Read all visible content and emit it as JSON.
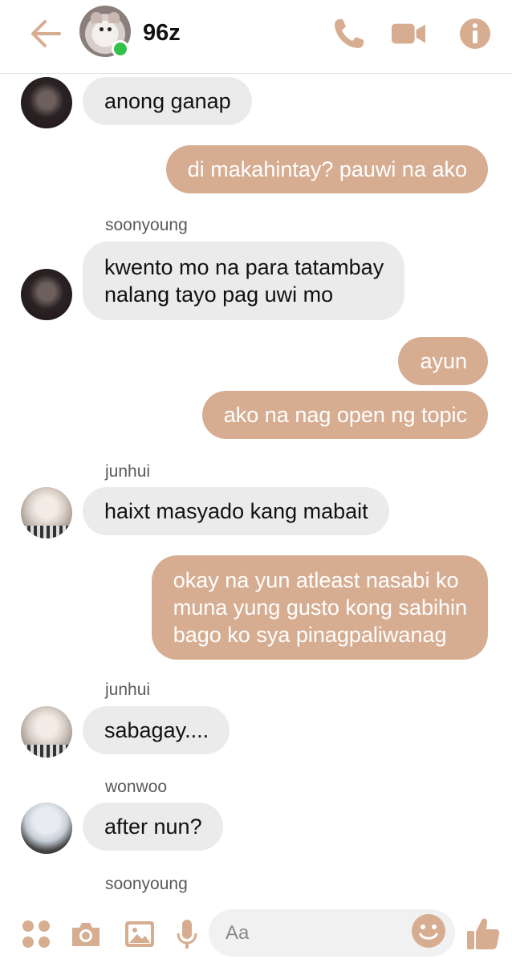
{
  "header": {
    "title": "96z",
    "online": true
  },
  "messages": [
    {
      "type": "in",
      "text": "anong ganap"
    },
    {
      "type": "out",
      "text": "di makahintay? pauwi na ako"
    },
    {
      "type": "name",
      "text": "soonyoung"
    },
    {
      "type": "in",
      "lines": [
        "kwento mo na para tatambay",
        "nalang tayo pag uwi mo"
      ]
    },
    {
      "type": "out",
      "text": "ayun"
    },
    {
      "type": "out",
      "text": "ako na nag open ng topic"
    },
    {
      "type": "name",
      "text": "junhui"
    },
    {
      "type": "in",
      "text": "haixt masyado kang mabait"
    },
    {
      "type": "out",
      "lines": [
        "okay na yun atleast nasabi ko",
        "muna yung gusto kong sabihin",
        "bago ko sya pinagpaliwanag"
      ]
    },
    {
      "type": "name",
      "text": "junhui"
    },
    {
      "type": "in",
      "text": "sabagay...."
    },
    {
      "type": "name",
      "text": "wonwoo"
    },
    {
      "type": "in",
      "text": "after nun?"
    },
    {
      "type": "name",
      "text": "soonyoung"
    }
  ],
  "composer": {
    "placeholder": "Aa"
  },
  "icons": {
    "back": "arrow-left-icon",
    "call": "phone-icon",
    "video": "video-camera-icon",
    "info": "info-icon",
    "menu": "four-dots-icon",
    "camera": "camera-icon",
    "gallery": "image-icon",
    "mic": "microphone-icon",
    "emoji": "smiley-icon",
    "like": "thumbs-up-icon"
  },
  "colors": {
    "accent": "#d7ad92",
    "incoming_bubble": "#ebebeb",
    "online": "#32c24a"
  }
}
